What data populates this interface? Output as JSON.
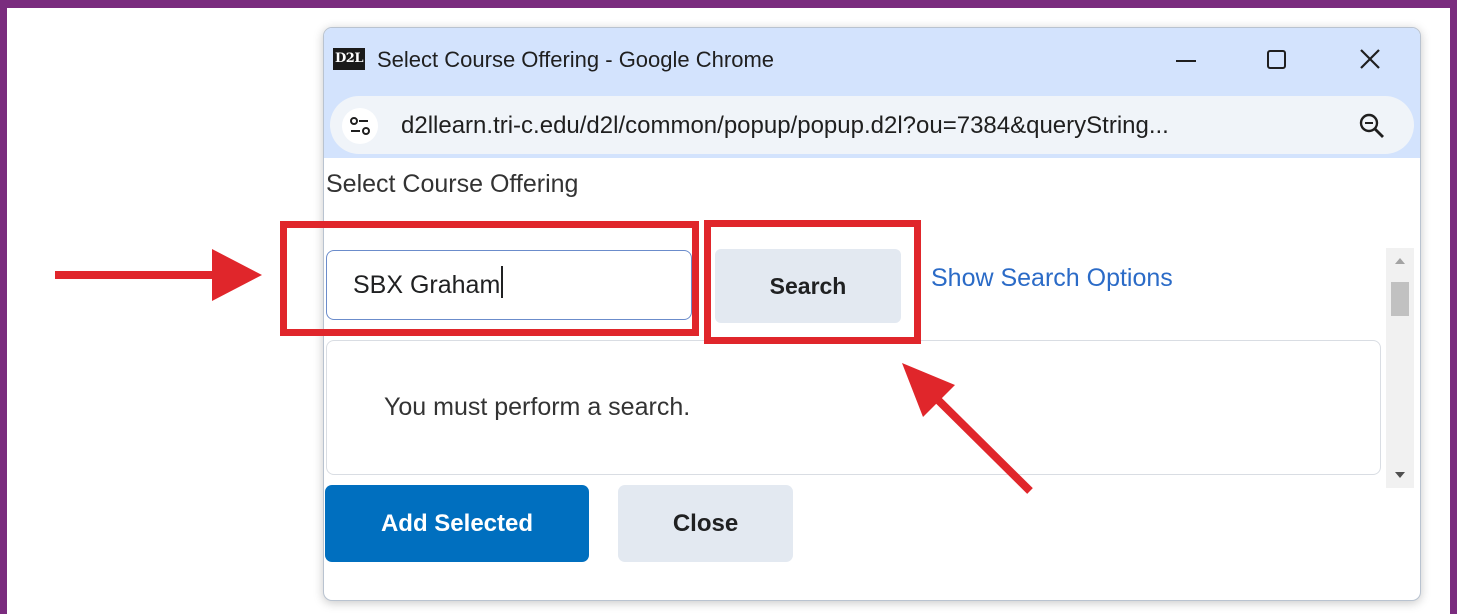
{
  "window": {
    "favicon_text": "D2L",
    "title": "Select Course Offering - Google Chrome",
    "url": "d2llearn.tri-c.edu/d2l/common/popup/popup.d2l?ou=7384&queryString..."
  },
  "popup": {
    "title": "Select Course Offering",
    "search_value": "SBX Graham",
    "search_button": "Search",
    "show_search_options": "Show Search Options",
    "results_message": "You must perform a search.",
    "add_selected_button": "Add Selected",
    "close_button": "Close"
  },
  "colors": {
    "frame": "#7a2c7e",
    "annotation": "#e0262b",
    "primary_button": "#006fbf",
    "link": "#2b6bc7"
  },
  "icons": [
    "minimize-icon",
    "maximize-icon",
    "close-icon",
    "site-settings-icon",
    "zoom-icon",
    "scroll-up-icon",
    "scroll-down-icon",
    "arrow-annotation"
  ]
}
